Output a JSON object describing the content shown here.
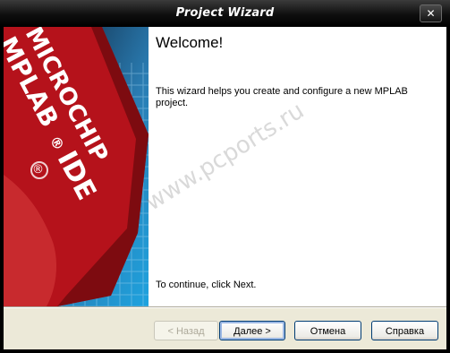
{
  "window": {
    "title": "Project Wizard",
    "close_glyph": "✕"
  },
  "banner": {
    "brand": "MICROCHIP",
    "product": "MPLAB",
    "suffix": "IDE",
    "registered": "®"
  },
  "content": {
    "heading": "Welcome!",
    "description": "This wizard helps you create and configure a new MPLAB project.",
    "continue_text": "To continue, click Next."
  },
  "buttons": {
    "back": "< Назад",
    "next": "Далее >",
    "cancel": "Отмена",
    "help": "Справка"
  },
  "watermark": "www.pcports.ru",
  "colors": {
    "title_bar": "#000000",
    "banner_blue": "#1ea3df",
    "banner_red": "#c0171b",
    "dialog_bg": "#ece9d8"
  }
}
